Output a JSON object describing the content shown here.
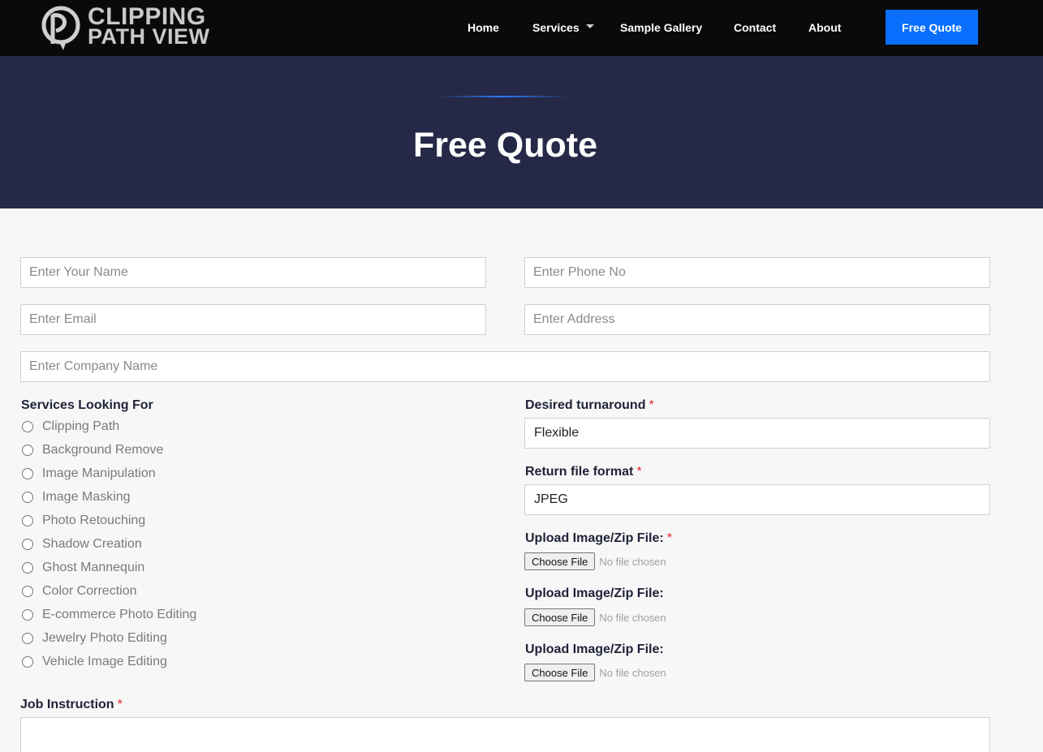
{
  "brand": {
    "line1": "CLIPPING",
    "line2": "PATH VIEW",
    "accent": "#0a6ffc"
  },
  "nav": {
    "home": "Home",
    "services": "Services",
    "gallery": "Sample Gallery",
    "contact": "Contact",
    "about": "About",
    "quote_button": "Free Quote"
  },
  "hero": {
    "title": "Free Quote"
  },
  "form": {
    "name_placeholder": "Enter Your Name",
    "phone_placeholder": "Enter Phone No",
    "email_placeholder": "Enter Email",
    "address_placeholder": "Enter Address",
    "company_placeholder": "Enter Company Name",
    "services_label": "Services Looking For",
    "services": [
      "Clipping Path",
      "Background Remove",
      "Image Manipulation",
      "Image Masking",
      "Photo Retouching",
      "Shadow Creation",
      "Ghost Mannequin",
      "Color Correction",
      "E-commerce Photo Editing",
      "Jewelry Photo Editing",
      "Vehicle Image Editing"
    ],
    "turnaround_label": "Desired turnaround",
    "turnaround_value": "Flexible",
    "format_label": "Return file format",
    "format_value": "JPEG",
    "uploads": [
      {
        "label": "Upload Image/Zip File:",
        "required": "*",
        "button": "Choose File",
        "status": "No file chosen"
      },
      {
        "label": "Upload Image/Zip File:",
        "required": "",
        "button": "Choose File",
        "status": "No file chosen"
      },
      {
        "label": "Upload Image/Zip File:",
        "required": "",
        "button": "Choose File",
        "status": "No file chosen"
      }
    ],
    "job_label": "Job Instruction",
    "required_mark": "*"
  }
}
